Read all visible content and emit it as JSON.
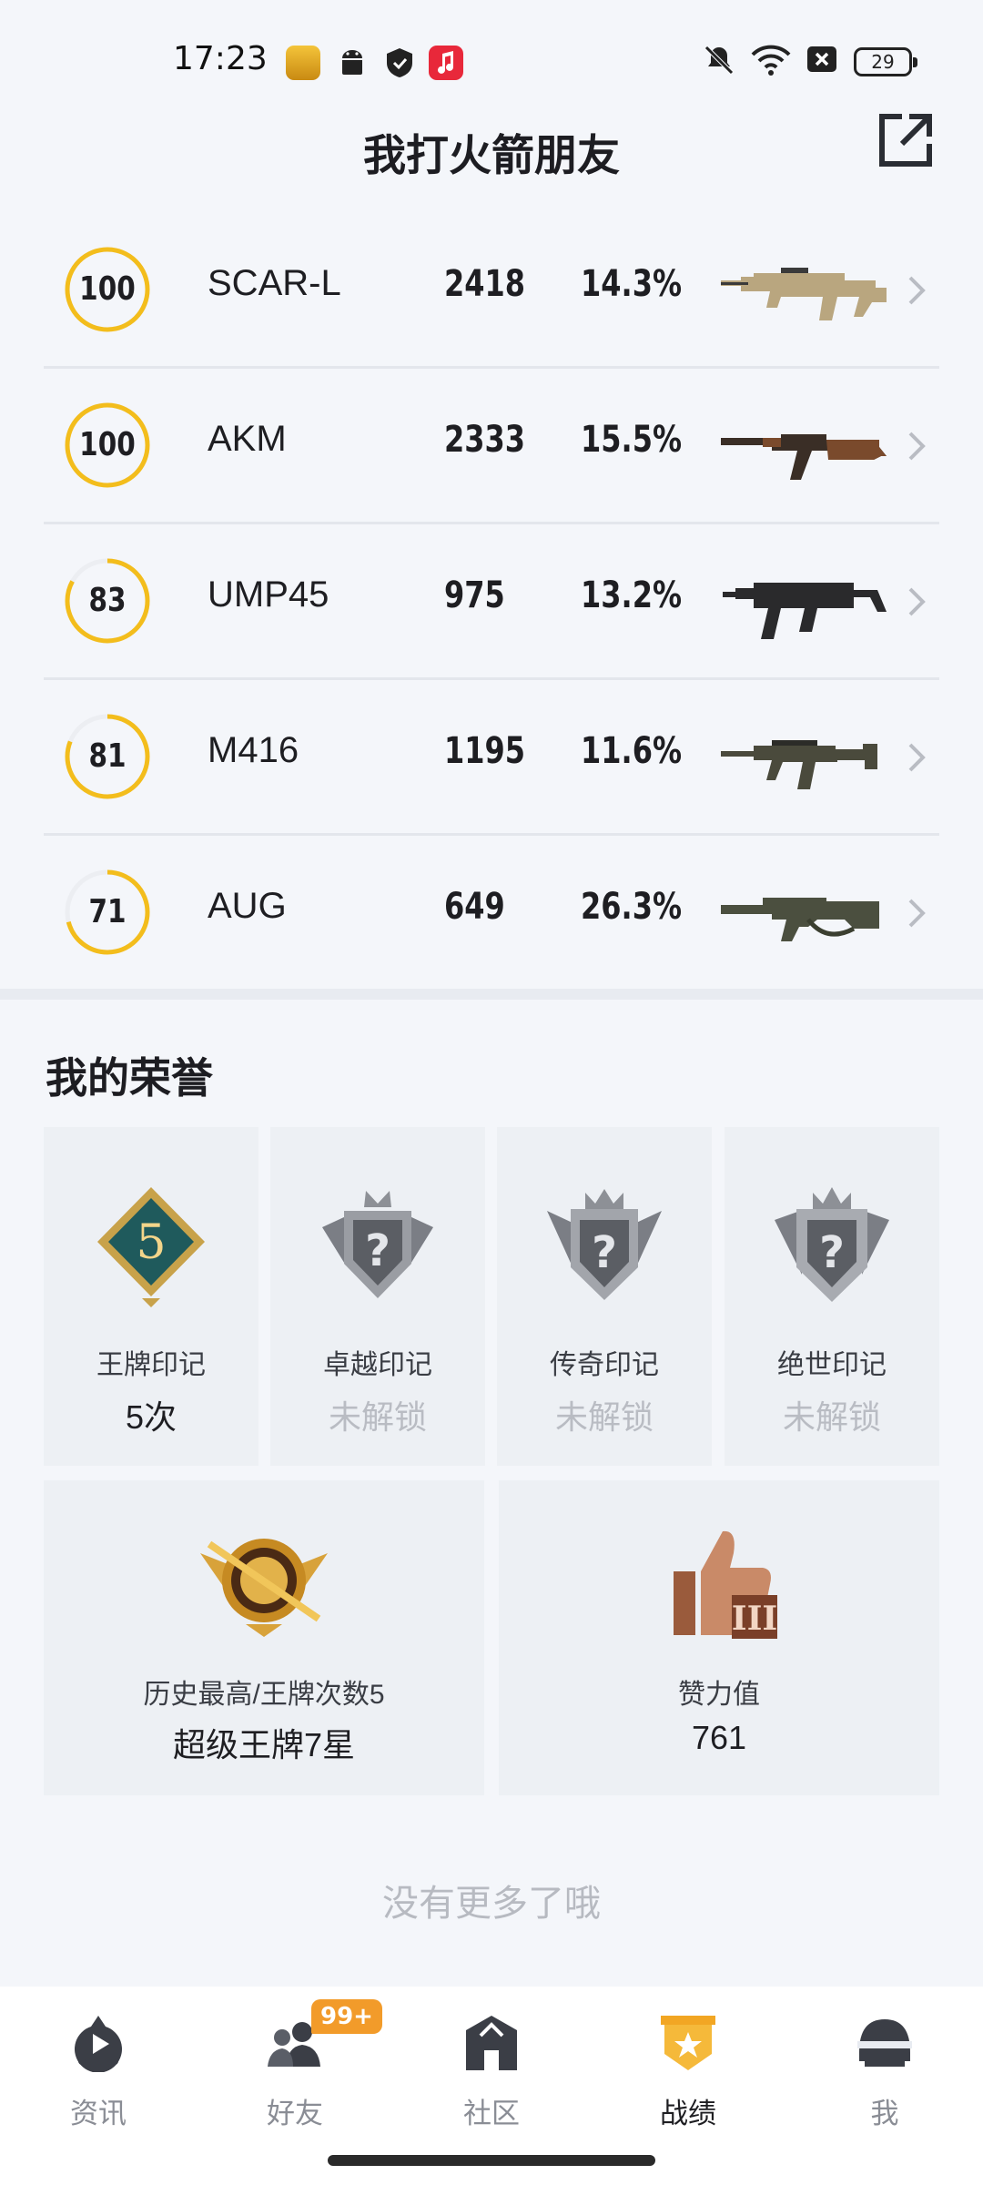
{
  "status_bar": {
    "time": "17:23",
    "battery": "29"
  },
  "header": {
    "title": "我打火箭朋友"
  },
  "weapons": [
    {
      "score": "100",
      "level": 100,
      "name": "SCAR-L",
      "count": "2418",
      "rate": "14.3%",
      "icon": "rifle-scar-icon",
      "color": "#b9a67f"
    },
    {
      "score": "100",
      "level": 100,
      "name": "AKM",
      "count": "2333",
      "rate": "15.5%",
      "icon": "rifle-akm-icon",
      "color": "#7a4a2c"
    },
    {
      "score": "83",
      "level": 83,
      "name": "UMP45",
      "count": "975",
      "rate": "13.2%",
      "icon": "smg-ump-icon",
      "color": "#2a2a2c"
    },
    {
      "score": "81",
      "level": 81,
      "name": "M416",
      "count": "1195",
      "rate": "11.6%",
      "icon": "rifle-m416-icon",
      "color": "#4a4a3c"
    },
    {
      "score": "71",
      "level": 71,
      "name": "AUG",
      "count": "649",
      "rate": "26.3%",
      "icon": "rifle-aug-icon",
      "color": "#4b4f3f"
    }
  ],
  "honors": {
    "title": "我的荣誉",
    "cards": [
      {
        "label": "王牌印记",
        "value": "5次",
        "locked": false,
        "icon": "ace-mark-badge-icon",
        "badge_text": "5"
      },
      {
        "label": "卓越印记",
        "value": "未解锁",
        "locked": true,
        "icon": "locked-badge-icon"
      },
      {
        "label": "传奇印记",
        "value": "未解锁",
        "locked": true,
        "icon": "locked-badge-icon"
      },
      {
        "label": "绝世印记",
        "value": "未解锁",
        "locked": true,
        "icon": "locked-badge-icon"
      }
    ],
    "highest": {
      "label": "历史最高/王牌次数5",
      "value": "超级王牌7星",
      "icon": "ace-tier-badge-icon"
    },
    "likes": {
      "label": "赞力值",
      "value": "761",
      "icon": "thumbs-up-badge-icon"
    }
  },
  "footer": {
    "no_more": "没有更多了哦"
  },
  "nav": {
    "items": [
      {
        "label": "资讯",
        "icon": "news-icon",
        "active": false
      },
      {
        "label": "好友",
        "icon": "friends-icon",
        "active": false
      },
      {
        "label": "社区",
        "icon": "community-icon",
        "active": false
      },
      {
        "label": "战绩",
        "icon": "record-icon",
        "active": true
      },
      {
        "label": "我",
        "icon": "profile-helmet-icon",
        "active": false
      }
    ],
    "friends_badge": "99+"
  },
  "colors": {
    "ring_accent": "#f3bd1c",
    "ring_track": "#eceef2",
    "active_nav": "#f2a623"
  }
}
